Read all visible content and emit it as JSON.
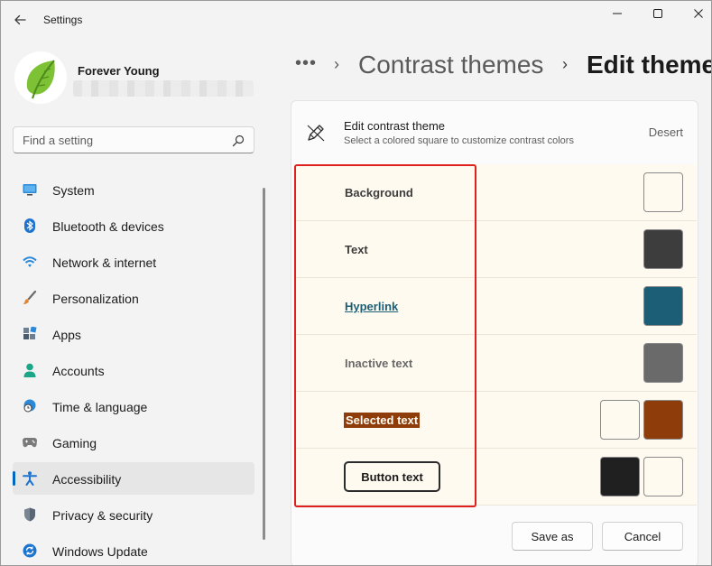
{
  "window": {
    "title": "Settings",
    "controls": [
      "minimize-icon",
      "maximize-icon",
      "close-icon"
    ]
  },
  "profile": {
    "name": "Forever Young",
    "avatar_icon": "leaf-icon"
  },
  "search": {
    "placeholder": "Find a setting",
    "icon": "search-icon"
  },
  "sidebar": {
    "items": [
      {
        "label": "System",
        "icon": "monitor-icon",
        "active": false
      },
      {
        "label": "Bluetooth & devices",
        "icon": "bluetooth-icon",
        "active": false
      },
      {
        "label": "Network & internet",
        "icon": "wifi-icon",
        "active": false
      },
      {
        "label": "Personalization",
        "icon": "brush-icon",
        "active": false
      },
      {
        "label": "Apps",
        "icon": "apps-icon",
        "active": false
      },
      {
        "label": "Accounts",
        "icon": "person-icon",
        "active": false
      },
      {
        "label": "Time & language",
        "icon": "globe-clock-icon",
        "active": false
      },
      {
        "label": "Gaming",
        "icon": "gamepad-icon",
        "active": false
      },
      {
        "label": "Accessibility",
        "icon": "accessibility-icon",
        "active": true
      },
      {
        "label": "Privacy & security",
        "icon": "shield-icon",
        "active": false
      },
      {
        "label": "Windows Update",
        "icon": "update-icon",
        "active": false
      }
    ]
  },
  "breadcrumb": {
    "more": "•••",
    "parent": "Contrast themes",
    "current": "Edit theme",
    "separator": "›"
  },
  "editor": {
    "title": "Edit contrast theme",
    "subtitle": "Select a colored square to customize contrast colors",
    "theme_name": "Desert",
    "rows": [
      {
        "label": "Background",
        "swatches": [
          "#fffaef"
        ]
      },
      {
        "label": "Text",
        "swatches": [
          "#3d3d3d"
        ]
      },
      {
        "label": "Hyperlink",
        "swatches": [
          "#1c5e75"
        ]
      },
      {
        "label": "Inactive text",
        "swatches": [
          "#6a6a6a"
        ]
      },
      {
        "label": "Selected text",
        "swatches": [
          "#fffaef",
          "#8f3c0b"
        ]
      },
      {
        "label": "Button text",
        "swatches": [
          "#202020",
          "#fffaef"
        ]
      }
    ]
  },
  "actions": {
    "save_as": "Save as",
    "cancel": "Cancel"
  },
  "colors": {
    "accent": "#0067c0",
    "highlight_box": "#e0201f",
    "theme_background": "#fffaef"
  }
}
